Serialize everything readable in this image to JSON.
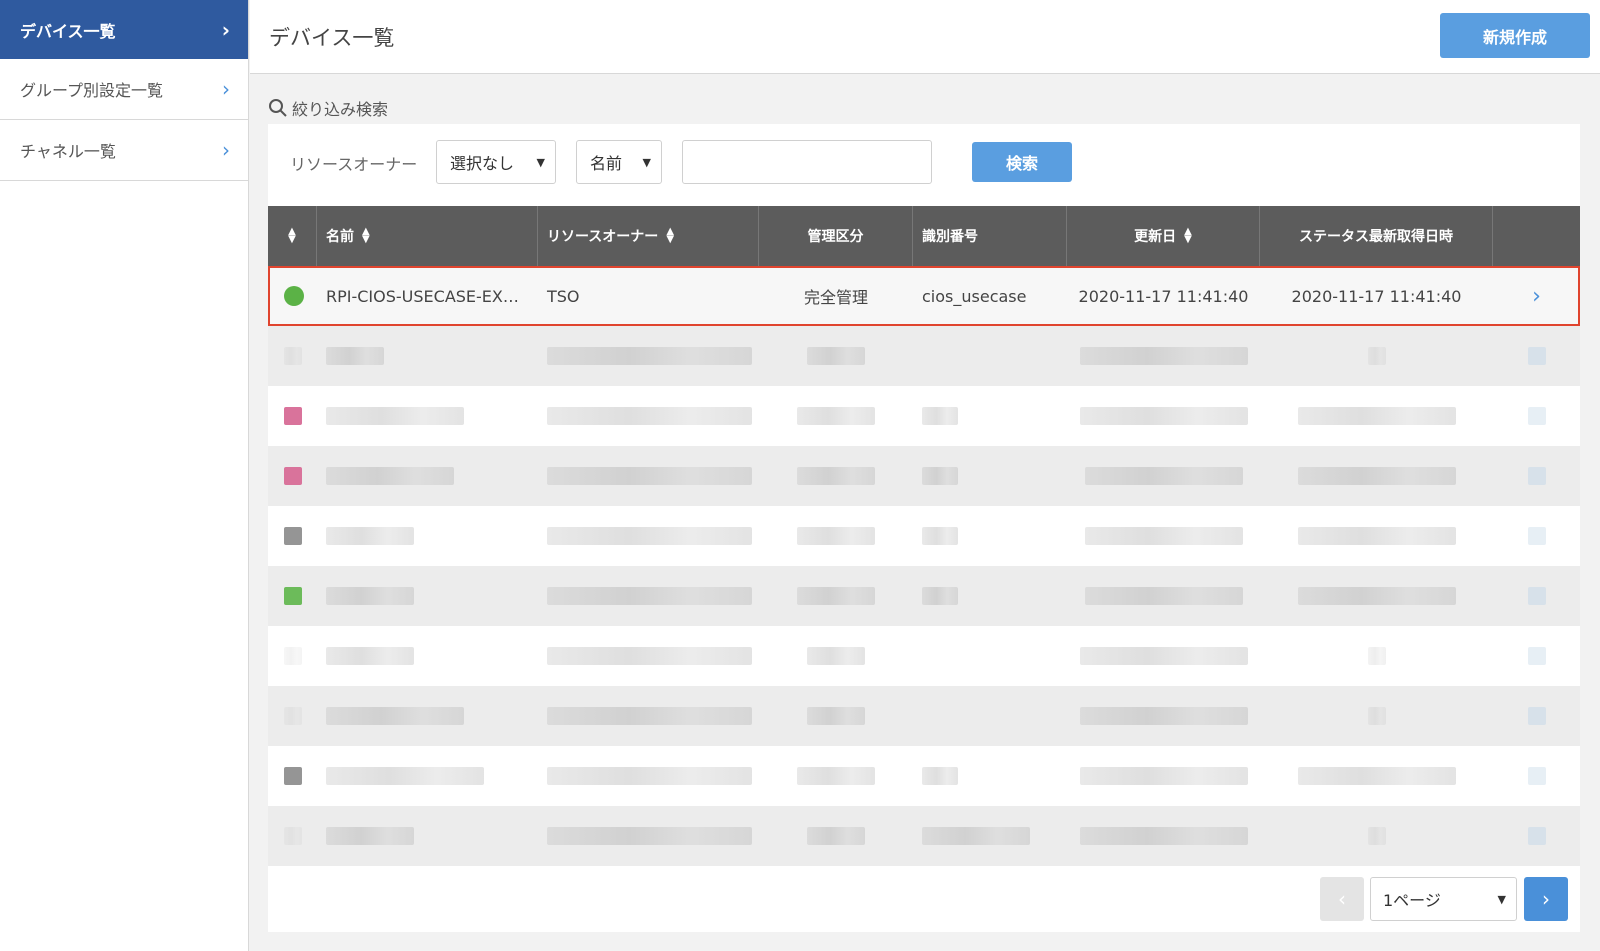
{
  "sidebar": {
    "items": [
      {
        "label": "デバイス一覧",
        "active": true
      },
      {
        "label": "グループ別設定一覧",
        "active": false
      },
      {
        "label": "チャネル一覧",
        "active": false
      }
    ]
  },
  "header": {
    "title": "デバイス一覧",
    "new_button": "新規作成"
  },
  "filter": {
    "title": "絞り込み検索",
    "owner_label": "リソースオーナー",
    "owner_select": "選択なし",
    "field_select": "名前",
    "search_value": "",
    "search_button": "検索"
  },
  "table": {
    "columns": [
      "",
      "名前",
      "リソースオーナー",
      "管理区分",
      "識別番号",
      "更新日",
      "ステータス最新取得日時",
      ""
    ],
    "first_row": {
      "status": "online",
      "name": "RPI-CIOS-USECASE-EX…",
      "owner": "TSO",
      "management": "完全管理",
      "identifier": "cios_usecase",
      "updated": "2020-11-17 11:41:40",
      "status_time": "2020-11-17 11:41:40"
    },
    "blurred_rows": 9
  },
  "pagination": {
    "page_select": "1ページ"
  },
  "colors": {
    "accent": "#5a9ee0",
    "sidebar_active": "#2f5a9f",
    "header_bg": "#5c5c5c",
    "highlight": "#e0442e",
    "status_online": "#5bb246"
  }
}
